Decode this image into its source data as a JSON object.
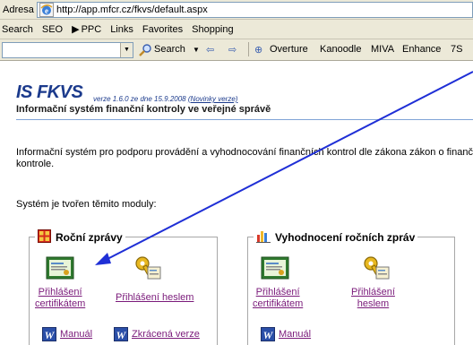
{
  "address_bar": {
    "label": "Adresa",
    "url": "http://app.mfcr.cz/fkvs/default.aspx"
  },
  "links_bar": {
    "items": [
      "Search",
      "SEO",
      "PPC",
      "Links",
      "Favorites",
      "Shopping"
    ]
  },
  "toolbar": {
    "search_label": "Search",
    "items": [
      "Overture",
      "Kanoodle",
      "MIVA",
      "Enhance",
      "7S"
    ]
  },
  "page": {
    "title": "IS FKVS",
    "version_text": "verze 1.6.0 ze dne 15.9.2008",
    "version_link": "(Novinky verze)",
    "subtitle": "Informační systém finanční kontroly ve veřejné správě",
    "intro": "Informační systém pro podporu provádění a vyhodnocování finančních kontrol dle zákona zákon o finanční kontrole.",
    "modules_line": "Systém je tvořen těmito moduly:"
  },
  "modules": [
    {
      "title": "Roční zprávy",
      "links": {
        "cert_line1": "Přihlášení",
        "cert_line2": "certifikátem",
        "password": "Přihlášení heslem",
        "manual": "Manuál",
        "short_version": "Zkrácená verze"
      }
    },
    {
      "title": "Vyhodnocení ročních zpráv",
      "links": {
        "cert_line1": "Přihlášení",
        "cert_line2": "certifikátem",
        "password_line1": "Přihlášení",
        "password_line2": "heslem",
        "manual": "Manuál"
      }
    }
  ],
  "annotation": {
    "arrow_color": "#1f2fd6"
  }
}
